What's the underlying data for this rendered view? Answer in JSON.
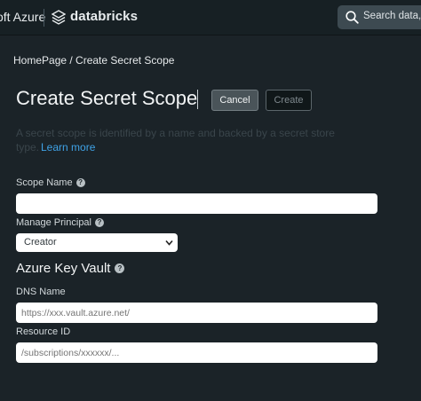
{
  "topbar": {
    "brand_partial": "oft Azure",
    "product": "databricks",
    "search_placeholder": "Search data, n"
  },
  "breadcrumb": "HomePage / Create Secret Scope",
  "page": {
    "title": "Create Secret Scope",
    "cancel_label": "Cancel",
    "create_label": "Create"
  },
  "description": {
    "line1": "A secret scope is identified by a name and backed by a secret store",
    "line2_prefix": "type.",
    "learn_more": "Learn more"
  },
  "form": {
    "scope_name": {
      "label": "Scope Name",
      "value": ""
    },
    "manage_principal": {
      "label": "Manage Principal",
      "selected": "Creator"
    },
    "key_vault_title": "Azure Key Vault",
    "dns_name": {
      "label": "DNS Name",
      "placeholder": "https://xxx.vault.azure.net/"
    },
    "resource_id": {
      "label": "Resource ID",
      "placeholder": "/subscriptions/xxxxxx/..."
    }
  },
  "colors": {
    "background": "#1b2328",
    "link": "#3fa2e6",
    "topbar": "#172024"
  }
}
